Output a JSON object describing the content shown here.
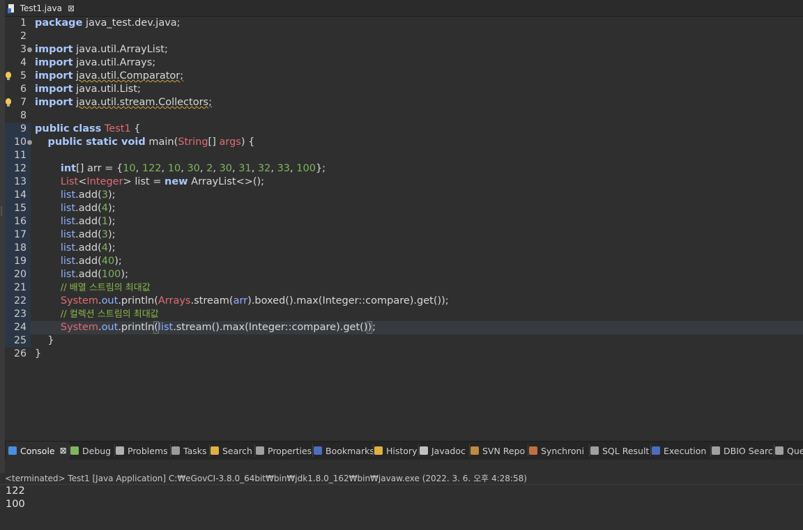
{
  "editor_tab": {
    "title": "Test1.java",
    "close": "⊠"
  },
  "code_lines": [
    {
      "n": "1",
      "tokens": [
        {
          "t": "package",
          "c": "kw"
        },
        {
          "t": " java_test.dev.java;",
          "c": "pl"
        }
      ]
    },
    {
      "n": "2",
      "tokens": []
    },
    {
      "n": "3",
      "fold": true,
      "tokens": [
        {
          "t": "import",
          "c": "kw"
        },
        {
          "t": " java.util.ArrayList;",
          "c": "pl"
        }
      ]
    },
    {
      "n": "4",
      "tokens": [
        {
          "t": "import",
          "c": "kw"
        },
        {
          "t": " java.util.Arrays;",
          "c": "pl"
        }
      ]
    },
    {
      "n": "5",
      "bulb": true,
      "tokens": [
        {
          "t": "import",
          "c": "kw"
        },
        {
          "t": " ",
          "c": "pl"
        },
        {
          "t": "java.util.Comparator;",
          "c": "pl warn"
        }
      ]
    },
    {
      "n": "6",
      "tokens": [
        {
          "t": "import",
          "c": "kw"
        },
        {
          "t": " java.util.List;",
          "c": "pl"
        }
      ]
    },
    {
      "n": "7",
      "bulb": true,
      "tokens": [
        {
          "t": "import",
          "c": "kw"
        },
        {
          "t": " ",
          "c": "pl"
        },
        {
          "t": "java.util.stream.Collectors;",
          "c": "pl warn"
        }
      ]
    },
    {
      "n": "8",
      "tokens": []
    },
    {
      "n": "9",
      "band": true,
      "tokens": [
        {
          "t": "public class",
          "c": "kw"
        },
        {
          "t": " ",
          "c": "pl"
        },
        {
          "t": "Test1",
          "c": "cls"
        },
        {
          "t": " {",
          "c": "pl"
        }
      ]
    },
    {
      "n": "10",
      "fold": true,
      "band": true,
      "tokens": [
        {
          "t": "    ",
          "c": "pl"
        },
        {
          "t": "public static void",
          "c": "kw"
        },
        {
          "t": " main(",
          "c": "pl"
        },
        {
          "t": "String",
          "c": "cls"
        },
        {
          "t": "[] ",
          "c": "pl"
        },
        {
          "t": "args",
          "c": "cls"
        },
        {
          "t": ") {",
          "c": "pl"
        }
      ]
    },
    {
      "n": "11",
      "band": true,
      "tokens": []
    },
    {
      "n": "12",
      "band": true,
      "tokens": [
        {
          "t": "        ",
          "c": "pl"
        },
        {
          "t": "int",
          "c": "kw"
        },
        {
          "t": "[] arr = {",
          "c": "pl"
        },
        {
          "t": "10",
          "c": "num"
        },
        {
          "t": ", ",
          "c": "pl"
        },
        {
          "t": "122",
          "c": "num"
        },
        {
          "t": ", ",
          "c": "pl"
        },
        {
          "t": "10",
          "c": "num"
        },
        {
          "t": ", ",
          "c": "pl"
        },
        {
          "t": "30",
          "c": "num"
        },
        {
          "t": ", ",
          "c": "pl"
        },
        {
          "t": "2",
          "c": "num"
        },
        {
          "t": ", ",
          "c": "pl"
        },
        {
          "t": "30",
          "c": "num"
        },
        {
          "t": ", ",
          "c": "pl"
        },
        {
          "t": "31",
          "c": "num"
        },
        {
          "t": ", ",
          "c": "pl"
        },
        {
          "t": "32",
          "c": "num"
        },
        {
          "t": ", ",
          "c": "pl"
        },
        {
          "t": "33",
          "c": "num"
        },
        {
          "t": ", ",
          "c": "pl"
        },
        {
          "t": "100",
          "c": "num"
        },
        {
          "t": "};",
          "c": "pl"
        }
      ]
    },
    {
      "n": "13",
      "band": true,
      "tokens": [
        {
          "t": "        ",
          "c": "pl"
        },
        {
          "t": "List",
          "c": "cls"
        },
        {
          "t": "<",
          "c": "pl"
        },
        {
          "t": "Integer",
          "c": "cls"
        },
        {
          "t": "> list = ",
          "c": "pl"
        },
        {
          "t": "new",
          "c": "kw"
        },
        {
          "t": " ArrayList<>();",
          "c": "pl"
        }
      ]
    },
    {
      "n": "14",
      "band": true,
      "tokens": [
        {
          "t": "        ",
          "c": "pl"
        },
        {
          "t": "list",
          "c": "fld"
        },
        {
          "t": ".add(",
          "c": "pl"
        },
        {
          "t": "3",
          "c": "num"
        },
        {
          "t": ");",
          "c": "pl"
        }
      ]
    },
    {
      "n": "15",
      "band": true,
      "tokens": [
        {
          "t": "        ",
          "c": "pl"
        },
        {
          "t": "list",
          "c": "fld"
        },
        {
          "t": ".add(",
          "c": "pl"
        },
        {
          "t": "4",
          "c": "num"
        },
        {
          "t": ");",
          "c": "pl"
        }
      ]
    },
    {
      "n": "16",
      "band": true,
      "tokens": [
        {
          "t": "        ",
          "c": "pl"
        },
        {
          "t": "list",
          "c": "fld"
        },
        {
          "t": ".add(",
          "c": "pl"
        },
        {
          "t": "1",
          "c": "num"
        },
        {
          "t": ");",
          "c": "pl"
        }
      ]
    },
    {
      "n": "17",
      "band": true,
      "tokens": [
        {
          "t": "        ",
          "c": "pl"
        },
        {
          "t": "list",
          "c": "fld"
        },
        {
          "t": ".add(",
          "c": "pl"
        },
        {
          "t": "3",
          "c": "num"
        },
        {
          "t": ");",
          "c": "pl"
        }
      ]
    },
    {
      "n": "18",
      "band": true,
      "tokens": [
        {
          "t": "        ",
          "c": "pl"
        },
        {
          "t": "list",
          "c": "fld"
        },
        {
          "t": ".add(",
          "c": "pl"
        },
        {
          "t": "4",
          "c": "num"
        },
        {
          "t": ");",
          "c": "pl"
        }
      ]
    },
    {
      "n": "19",
      "band": true,
      "tokens": [
        {
          "t": "        ",
          "c": "pl"
        },
        {
          "t": "list",
          "c": "fld"
        },
        {
          "t": ".add(",
          "c": "pl"
        },
        {
          "t": "40",
          "c": "num"
        },
        {
          "t": ");",
          "c": "pl"
        }
      ]
    },
    {
      "n": "20",
      "band": true,
      "tokens": [
        {
          "t": "        ",
          "c": "pl"
        },
        {
          "t": "list",
          "c": "fld"
        },
        {
          "t": ".add(",
          "c": "pl"
        },
        {
          "t": "100",
          "c": "num"
        },
        {
          "t": ");",
          "c": "pl"
        }
      ]
    },
    {
      "n": "21",
      "band": true,
      "tokens": [
        {
          "t": "        ",
          "c": "pl"
        },
        {
          "t": "// 배열 스트림의 최대값",
          "c": "cm"
        }
      ]
    },
    {
      "n": "22",
      "band": true,
      "tokens": [
        {
          "t": "        ",
          "c": "pl"
        },
        {
          "t": "System",
          "c": "cls"
        },
        {
          "t": ".",
          "c": "pl"
        },
        {
          "t": "out",
          "c": "fld"
        },
        {
          "t": ".println(",
          "c": "pl"
        },
        {
          "t": "Arrays",
          "c": "cls"
        },
        {
          "t": ".stream(",
          "c": "pl"
        },
        {
          "t": "arr",
          "c": "fld"
        },
        {
          "t": ").boxed().max(Integer::compare).get());",
          "c": "pl"
        }
      ]
    },
    {
      "n": "23",
      "band": true,
      "tokens": [
        {
          "t": "        ",
          "c": "pl"
        },
        {
          "t": "// 컬렉션 스트림의 최대값",
          "c": "cm"
        }
      ]
    },
    {
      "n": "24",
      "band": true,
      "current": true,
      "tokens": [
        {
          "t": "        ",
          "c": "pl"
        },
        {
          "t": "System",
          "c": "cls"
        },
        {
          "t": ".",
          "c": "pl"
        },
        {
          "t": "out",
          "c": "fld"
        },
        {
          "t": ".println",
          "c": "pl"
        },
        {
          "t": "(",
          "c": "pl hl-par"
        },
        {
          "t": "list",
          "c": "fld"
        },
        {
          "t": ".stream().max(Integer::compare).get()",
          "c": "pl"
        },
        {
          "t": ")",
          "c": "pl hl-par"
        },
        {
          "t": "CARET",
          "c": "caret"
        },
        {
          "t": ";",
          "c": "pl"
        }
      ]
    },
    {
      "n": "25",
      "band": true,
      "tokens": [
        {
          "t": "    }",
          "c": "pl"
        }
      ]
    },
    {
      "n": "26",
      "tokens": [
        {
          "t": "}",
          "c": "pl"
        }
      ]
    }
  ],
  "views": [
    {
      "label": "Console",
      "icon": "console-icon",
      "color": "#4a8fe0",
      "active": true,
      "close": "⊠"
    },
    {
      "label": "Debug",
      "icon": "bug-icon",
      "color": "#7fb55f"
    },
    {
      "label": "Problems",
      "icon": "problems-icon",
      "color": "#b0b0b0"
    },
    {
      "label": "Tasks",
      "icon": "tasks-icon",
      "color": "#9a9a9a"
    },
    {
      "label": "Search",
      "icon": "search-icon",
      "color": "#e0b040"
    },
    {
      "label": "Properties",
      "icon": "properties-icon",
      "color": "#a0a0a0"
    },
    {
      "label": "Bookmarks",
      "icon": "bookmark-icon",
      "color": "#4a6fc0"
    },
    {
      "label": "History",
      "icon": "history-icon",
      "color": "#e0b040"
    },
    {
      "label": "Javadoc",
      "icon": "javadoc-icon",
      "color": "#c0c0c0"
    },
    {
      "label": "SVN Repo",
      "icon": "svn-icon",
      "color": "#c08a40"
    },
    {
      "label": "Synchroni",
      "icon": "sync-icon",
      "color": "#c07040"
    },
    {
      "label": "SQL Result",
      "icon": "table-icon",
      "color": "#a0a0a0"
    },
    {
      "label": "Execution",
      "icon": "execution-icon",
      "color": "#4a6fc0"
    },
    {
      "label": "DBIO Searc",
      "icon": "dbio-icon",
      "color": "#a0a0a0"
    },
    {
      "label": "Que",
      "icon": "query-icon",
      "color": "#a0a0a0"
    }
  ],
  "console": {
    "header": "<terminated> Test1 [Java Application] C:₩eGovCI-3.8.0_64bit₩bin₩jdk1.8.0_162₩bin₩javaw.exe  (2022. 3. 6. 오후 4:28:58)",
    "output": [
      "122",
      "100"
    ]
  }
}
